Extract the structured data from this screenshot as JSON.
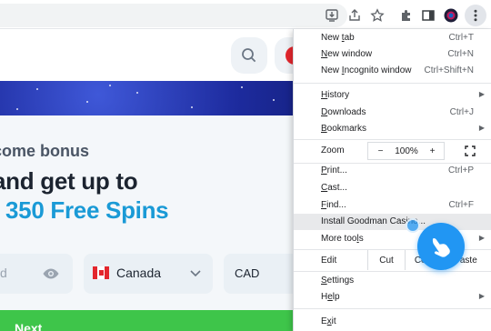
{
  "browser": {
    "toolbar_icons": [
      "install-app-icon",
      "share-icon",
      "bookmark-star-icon",
      "extensions-icon",
      "side-panel-icon",
      "profile-icon",
      "more-menu-icon"
    ]
  },
  "site": {
    "welcome": "come bonus",
    "headline_line1": "and get up to",
    "headline_line2": "350 Free Spins",
    "password_placeholder": "d",
    "country": "Canada",
    "currency": "CAD",
    "next_button": "Next",
    "colors": {
      "accent": "#1a9ad6",
      "button": "#3ec54a",
      "flag_red": "#e3262d"
    }
  },
  "menu": {
    "items": [
      {
        "label": "New tab",
        "underline": "t",
        "shortcut": "Ctrl+T"
      },
      {
        "label": "New window",
        "underline": "w",
        "shortcut": "Ctrl+N"
      },
      {
        "label": "New Incognito window",
        "underline": "I",
        "shortcut": "Ctrl+Shift+N"
      },
      {
        "label": "History",
        "underline": "H",
        "shortcut": ""
      },
      {
        "label": "Downloads",
        "underline": "D",
        "shortcut": "Ctrl+J"
      },
      {
        "label": "Bookmarks",
        "underline": "B",
        "shortcut": ""
      },
      {
        "label": "Print...",
        "underline": "P",
        "shortcut": "Ctrl+P"
      },
      {
        "label": "Cast...",
        "underline": "C",
        "shortcut": ""
      },
      {
        "label": "Find...",
        "underline": "F",
        "shortcut": "Ctrl+F"
      },
      {
        "label": "Install Goodman Casino...",
        "underline": "",
        "shortcut": ""
      },
      {
        "label": "More tools",
        "underline": "l",
        "shortcut": ""
      },
      {
        "label": "Settings",
        "underline": "S",
        "shortcut": ""
      },
      {
        "label": "Help",
        "underline": "e",
        "shortcut": ""
      },
      {
        "label": "Exit",
        "underline": "x",
        "shortcut": ""
      }
    ],
    "zoom": {
      "label": "Zoom",
      "minus": "−",
      "value": "100%",
      "plus": "+"
    },
    "edit": {
      "label": "Edit",
      "cut": "Cut",
      "copy": "Copy",
      "paste": "Paste"
    }
  }
}
